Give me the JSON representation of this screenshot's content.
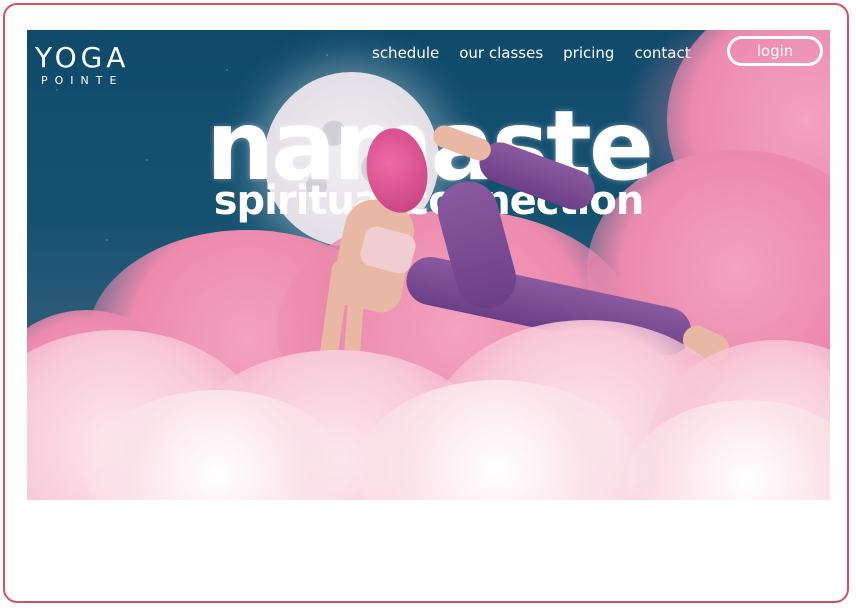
{
  "brand": {
    "logo_main": "YOGA",
    "logo_sub": "POINTE"
  },
  "nav": {
    "items": [
      {
        "label": "schedule"
      },
      {
        "label": "our classes"
      },
      {
        "label": "pricing"
      },
      {
        "label": "contact"
      }
    ],
    "login_label": "login"
  },
  "hero": {
    "title": "namaste",
    "subtitle": "spiritual connection"
  },
  "colors": {
    "frame_border": "#d8505f",
    "sky": "#155270",
    "cloud_pink": "#ec8aae",
    "cloud_light": "#fde8ef"
  }
}
